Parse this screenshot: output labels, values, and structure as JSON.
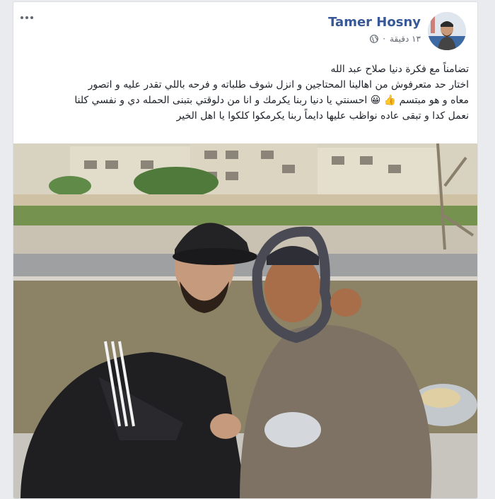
{
  "post": {
    "author_name": "Tamer Hosny",
    "timestamp": "١٣ دقيقة",
    "privacy_icon": "globe-icon",
    "more_icon": "more-options-icon",
    "text_line_1": "تضامناً مع فكرة دنيا صلاح عبد الله",
    "text_line_2": "اختار حد متعرفوش من اهالينا المحتاجين و انزل شوف طلباته و فرحه باللي تقدر عليه و اتصور",
    "text_line_3_start": "معاه و هو مبتسم",
    "text_line_3_emoji_1": "👍",
    "text_line_3_emoji_2": "😀",
    "text_line_3_end": "احسنتي يا دنيا ربنا يكرمك و انا من دلوقتي بتبنى الحمله دي و نفسي كلنا",
    "text_line_4": "نعمل كدا و تبقى عاده نواظب عليها دايماً ربنا يكرمكوا كلكوا يا اهل الخير"
  },
  "photo": {
    "description_icon": "post-photo"
  },
  "colors": {
    "author_link": "#385898",
    "text": "#1d2129",
    "meta": "#616770",
    "card_border": "#dddfe2",
    "page_bg": "#e9ebee"
  }
}
